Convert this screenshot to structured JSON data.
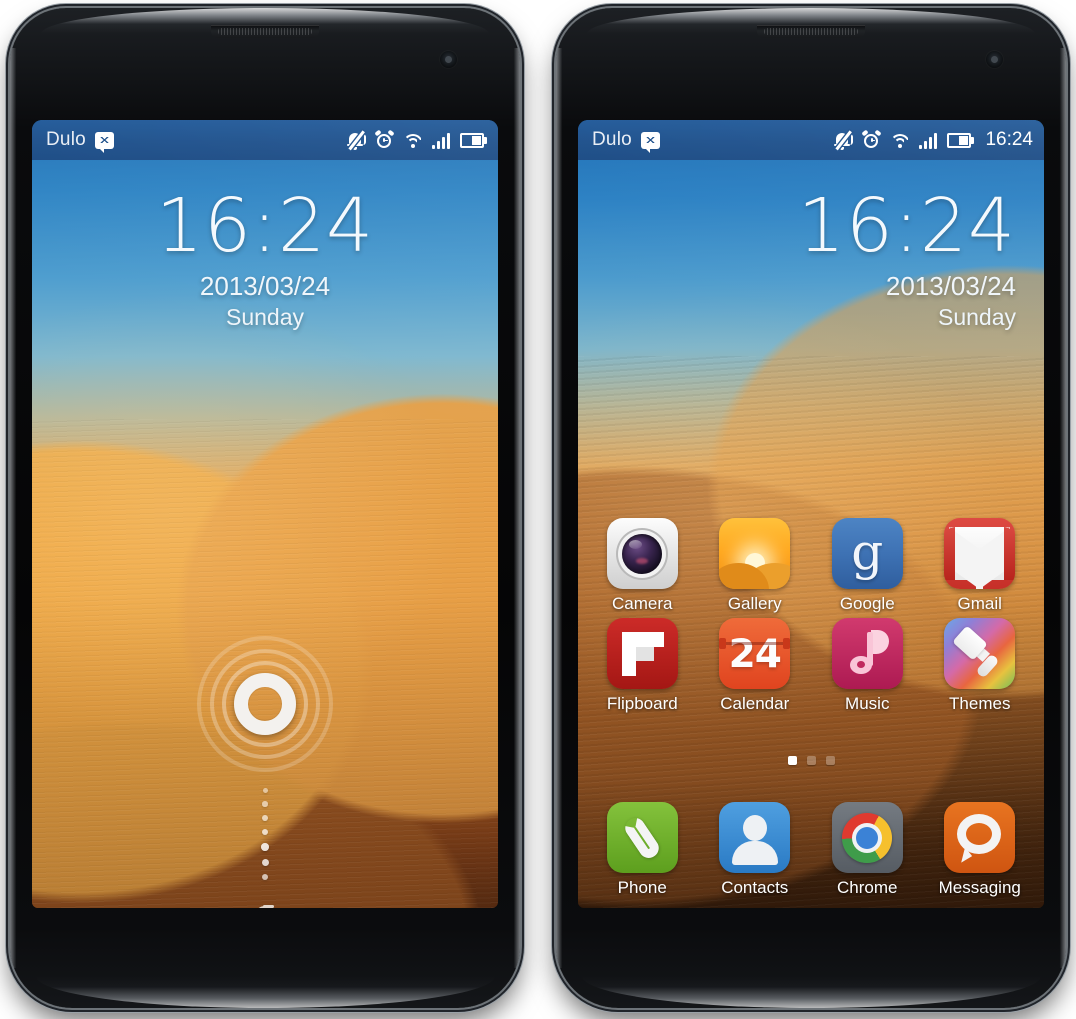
{
  "status_bar": {
    "carrier": "Dulo",
    "notification_icon": "message-bubble-icon",
    "icons": [
      "ringer-off-icon",
      "alarm-clock-icon",
      "wifi-icon",
      "signal-bars-icon",
      "battery-icon"
    ],
    "time": "16:24",
    "background_color": "#1c4f8b"
  },
  "lock_screen": {
    "time": "16:24",
    "date": "2013/03/24",
    "weekday": "Sunday",
    "unlock_ring": "unlock-ring-icon",
    "lock_glyph": "lock-icon"
  },
  "home_screen": {
    "time": "16:24",
    "date": "2013/03/24",
    "weekday": "Sunday",
    "rows": [
      [
        {
          "label": "Camera",
          "icon": "camera-icon"
        },
        {
          "label": "Gallery",
          "icon": "gallery-icon"
        },
        {
          "label": "Google",
          "icon": "google-icon",
          "glyph": "g"
        },
        {
          "label": "Gmail",
          "icon": "gmail-icon"
        }
      ],
      [
        {
          "label": "Flipboard",
          "icon": "flipboard-icon"
        },
        {
          "label": "Calendar",
          "icon": "calendar-icon",
          "day_number": "24"
        },
        {
          "label": "Music",
          "icon": "music-icon"
        },
        {
          "label": "Themes",
          "icon": "themes-icon"
        }
      ]
    ],
    "dock": [
      {
        "label": "Phone",
        "icon": "phone-icon"
      },
      {
        "label": "Contacts",
        "icon": "contacts-icon"
      },
      {
        "label": "Chrome",
        "icon": "chrome-icon"
      },
      {
        "label": "Messaging",
        "icon": "messaging-icon"
      }
    ],
    "page_indicator": {
      "total": 3,
      "active_index": 0
    }
  },
  "theme_colors": {
    "status_bar_blue": "#1c4f8b",
    "sky_blue": "#1f6fb4",
    "sand_orange": "#eda24a",
    "sand_brown": "#5d2f13"
  }
}
